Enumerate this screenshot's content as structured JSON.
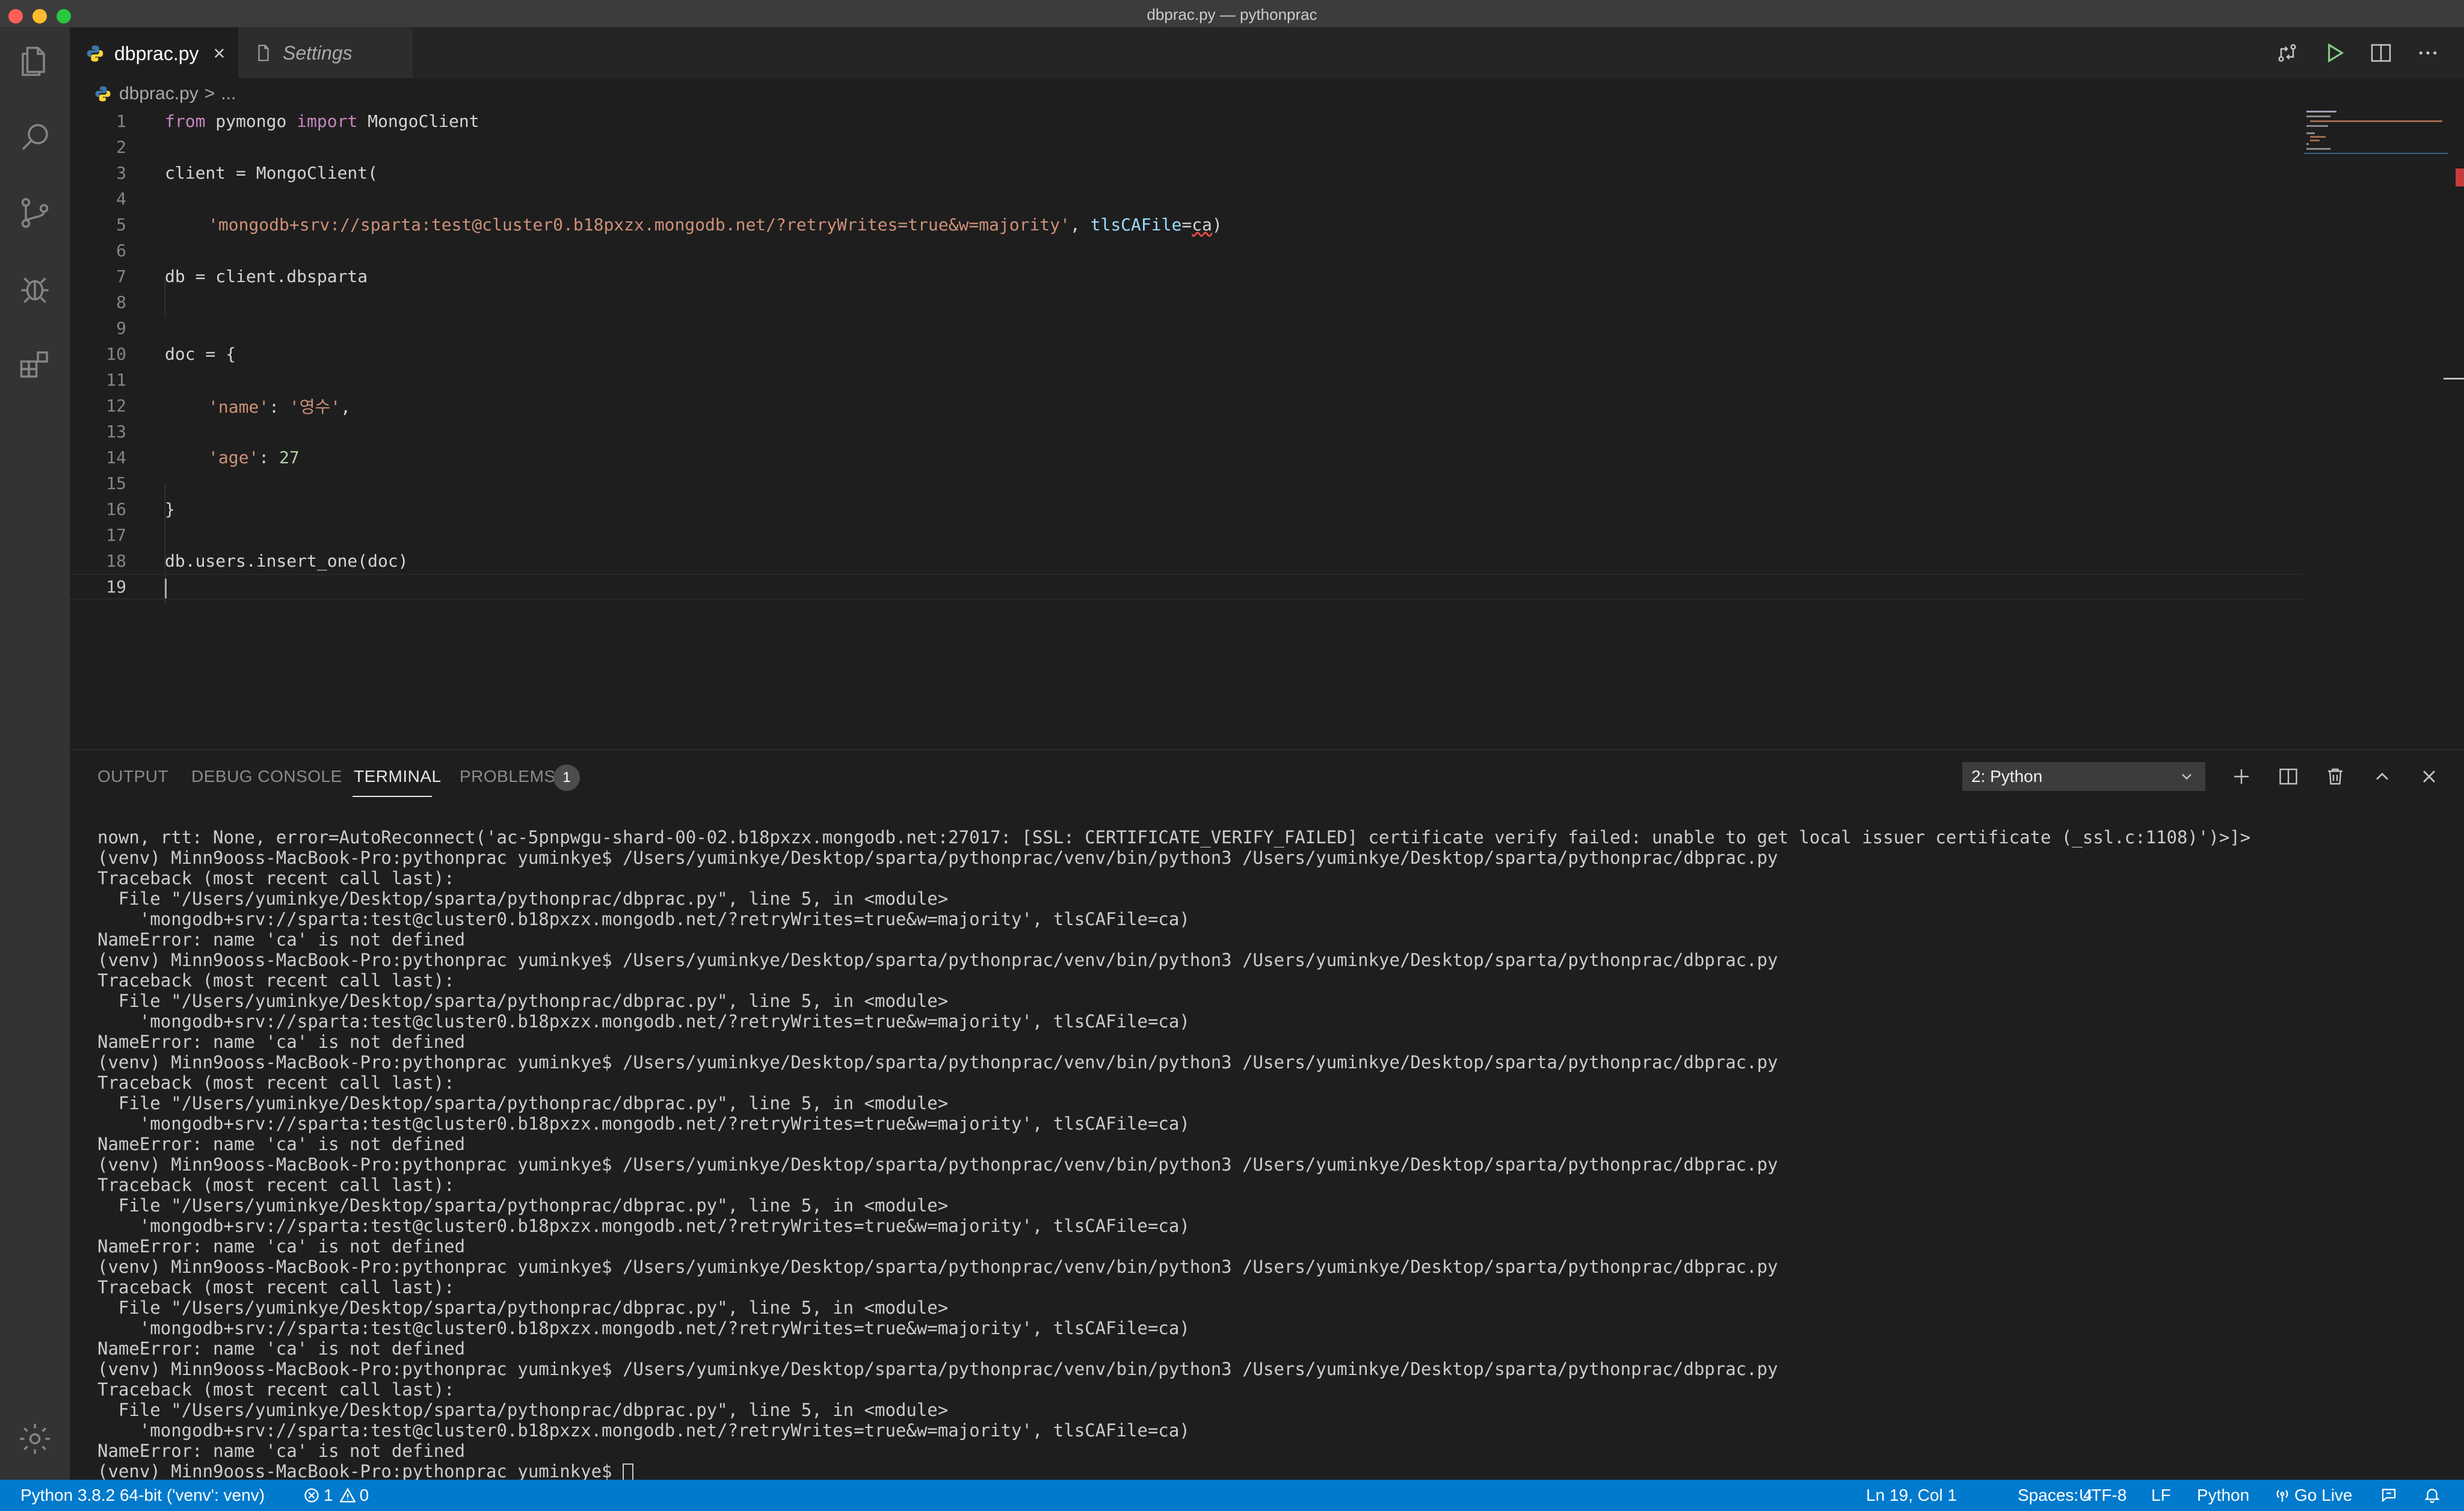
{
  "window": {
    "title": "dbprac.py — pythonprac"
  },
  "tabs": [
    {
      "label": "dbprac.py",
      "close": "×"
    },
    {
      "label": "Settings"
    }
  ],
  "breadcrumb": {
    "file": "dbprac.py",
    "separator": ">",
    "rest": "..."
  },
  "editor": {
    "line_numbers": [
      "1",
      "2",
      "3",
      "4",
      "5",
      "6",
      "7",
      "8",
      "9",
      "10",
      "11",
      "12",
      "13",
      "14",
      "15",
      "16",
      "17",
      "18",
      "19"
    ],
    "code": {
      "l1_kw1": "from",
      "l1_mid": " pymongo ",
      "l1_kw2": "import",
      "l1_end": " MongoClient",
      "l3": "client = MongoClient(",
      "l5_str": "'mongodb+srv://sparta:test@cluster0.b18pxzx.mongodb.net/?retryWrites=true&w=majority'",
      "l5_comma": ", ",
      "l5_param": "tlsCAFile",
      "l5_eq": "=",
      "l5_arg": "ca",
      "l5_close": ")",
      "l7": "db = client.dbsparta",
      "l10": "doc = {",
      "l12_key": "'name'",
      "l12_colon": ": ",
      "l12_val": "'영수'",
      "l12_comma": ",",
      "l14_key": "'age'",
      "l14_colon": ": ",
      "l14_val": "27",
      "l16": "}",
      "l18": "db.users.insert_one(doc)"
    }
  },
  "panel": {
    "tabs": {
      "output": "OUTPUT",
      "debug": "DEBUG CONSOLE",
      "terminal": "TERMINAL",
      "problems": "PROBLEMS"
    },
    "problems_count": "1",
    "terminal_select": "2: Python",
    "terminal_lines": [
      "nown, rtt: None, error=AutoReconnect('ac-5pnpwgu-shard-00-02.b18pxzx.mongodb.net:27017: [SSL: CERTIFICATE_VERIFY_FAILED] certificate verify failed: unable to get local issuer certificate (_ssl.c:1108)')>]>",
      "(venv) Minn9ooss-MacBook-Pro:pythonprac yuminkye$ /Users/yuminkye/Desktop/sparta/pythonprac/venv/bin/python3 /Users/yuminkye/Desktop/sparta/pythonprac/dbprac.py",
      "Traceback (most recent call last):",
      "  File \"/Users/yuminkye/Desktop/sparta/pythonprac/dbprac.py\", line 5, in <module>",
      "    'mongodb+srv://sparta:test@cluster0.b18pxzx.mongodb.net/?retryWrites=true&w=majority', tlsCAFile=ca)",
      "NameError: name 'ca' is not defined",
      "(venv) Minn9ooss-MacBook-Pro:pythonprac yuminkye$ /Users/yuminkye/Desktop/sparta/pythonprac/venv/bin/python3 /Users/yuminkye/Desktop/sparta/pythonprac/dbprac.py",
      "Traceback (most recent call last):",
      "  File \"/Users/yuminkye/Desktop/sparta/pythonprac/dbprac.py\", line 5, in <module>",
      "    'mongodb+srv://sparta:test@cluster0.b18pxzx.mongodb.net/?retryWrites=true&w=majority', tlsCAFile=ca)",
      "NameError: name 'ca' is not defined",
      "(venv) Minn9ooss-MacBook-Pro:pythonprac yuminkye$ /Users/yuminkye/Desktop/sparta/pythonprac/venv/bin/python3 /Users/yuminkye/Desktop/sparta/pythonprac/dbprac.py",
      "Traceback (most recent call last):",
      "  File \"/Users/yuminkye/Desktop/sparta/pythonprac/dbprac.py\", line 5, in <module>",
      "    'mongodb+srv://sparta:test@cluster0.b18pxzx.mongodb.net/?retryWrites=true&w=majority', tlsCAFile=ca)",
      "NameError: name 'ca' is not defined",
      "(venv) Minn9ooss-MacBook-Pro:pythonprac yuminkye$ /Users/yuminkye/Desktop/sparta/pythonprac/venv/bin/python3 /Users/yuminkye/Desktop/sparta/pythonprac/dbprac.py",
      "Traceback (most recent call last):",
      "  File \"/Users/yuminkye/Desktop/sparta/pythonprac/dbprac.py\", line 5, in <module>",
      "    'mongodb+srv://sparta:test@cluster0.b18pxzx.mongodb.net/?retryWrites=true&w=majority', tlsCAFile=ca)",
      "NameError: name 'ca' is not defined",
      "(venv) Minn9ooss-MacBook-Pro:pythonprac yuminkye$ /Users/yuminkye/Desktop/sparta/pythonprac/venv/bin/python3 /Users/yuminkye/Desktop/sparta/pythonprac/dbprac.py",
      "Traceback (most recent call last):",
      "  File \"/Users/yuminkye/Desktop/sparta/pythonprac/dbprac.py\", line 5, in <module>",
      "    'mongodb+srv://sparta:test@cluster0.b18pxzx.mongodb.net/?retryWrites=true&w=majority', tlsCAFile=ca)",
      "NameError: name 'ca' is not defined",
      "(venv) Minn9ooss-MacBook-Pro:pythonprac yuminkye$ /Users/yuminkye/Desktop/sparta/pythonprac/venv/bin/python3 /Users/yuminkye/Desktop/sparta/pythonprac/dbprac.py",
      "Traceback (most recent call last):",
      "  File \"/Users/yuminkye/Desktop/sparta/pythonprac/dbprac.py\", line 5, in <module>",
      "    'mongodb+srv://sparta:test@cluster0.b18pxzx.mongodb.net/?retryWrites=true&w=majority', tlsCAFile=ca)",
      "NameError: name 'ca' is not defined"
    ],
    "prompt": "(venv) Minn9ooss-MacBook-Pro:pythonprac yuminkye$ "
  },
  "statusbar": {
    "interpreter": "Python 3.8.2 64-bit ('venv': venv)",
    "errors": "1",
    "warnings": "0",
    "position": "Ln 19, Col 1",
    "spaces": "Spaces: 4",
    "encoding": "UTF-8",
    "eol": "LF",
    "language": "Python",
    "golive": "Go Live"
  },
  "icons": [
    "files-icon",
    "search-icon",
    "source-control-icon",
    "debug-icon",
    "extensions-icon",
    "gear-icon",
    "python-file-icon",
    "settings-file-icon",
    "compare-changes-icon",
    "run-icon",
    "split-editor-icon",
    "more-actions-icon",
    "add-terminal-icon",
    "split-terminal-icon",
    "trash-icon",
    "maximize-panel-icon",
    "close-panel-icon",
    "error-icon",
    "warning-icon",
    "broadcast-icon",
    "feedback-icon",
    "bell-icon"
  ],
  "colors": {
    "statusbar": "#007acc",
    "keyword": "#c586c0",
    "string": "#ce9178",
    "parameter": "#9cdcfe",
    "number": "#b5cea8"
  }
}
